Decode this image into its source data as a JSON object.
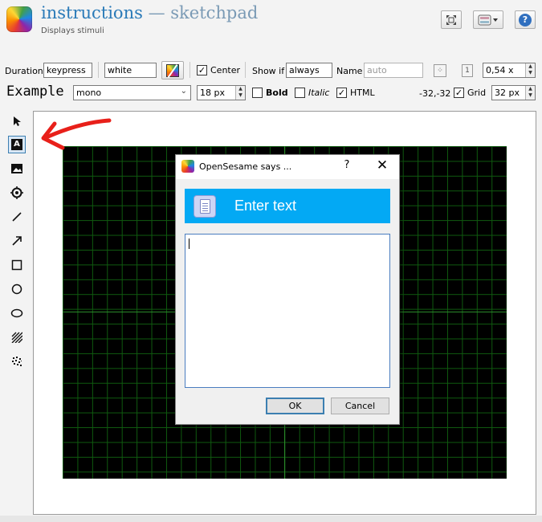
{
  "header": {
    "title": "instructions",
    "title_sep": "—",
    "plugin": "sketchpad",
    "subtitle": "Displays stimuli"
  },
  "settings_row": {
    "duration_label": "Duration",
    "duration_value": "keypress",
    "color_value": "white",
    "center_label": "Center",
    "center_checked": true,
    "show_if_label": "Show if",
    "show_if_value": "always",
    "name_label": "Name",
    "name_placeholder": "auto",
    "zoom_value": "0,54 x"
  },
  "style_row": {
    "example_text": "Example",
    "font_family": "mono",
    "font_size": "18 px",
    "bold_label": "Bold",
    "italic_label": "Italic",
    "html_label": "HTML",
    "html_checked": true,
    "coordinates": "-32,-32",
    "grid_label": "Grid",
    "grid_checked": true,
    "grid_size": "32 px"
  },
  "tools": [
    {
      "name": "pointer",
      "icon": "pointer-icon"
    },
    {
      "name": "text",
      "icon": "text-icon",
      "active": true
    },
    {
      "name": "image",
      "icon": "image-icon"
    },
    {
      "name": "fixdot",
      "icon": "fixdot-icon"
    },
    {
      "name": "line",
      "icon": "line-icon"
    },
    {
      "name": "arrow",
      "icon": "arrow-icon"
    },
    {
      "name": "rect",
      "icon": "rect-icon"
    },
    {
      "name": "circle",
      "icon": "circle-icon"
    },
    {
      "name": "ellipse",
      "icon": "ellipse-icon"
    },
    {
      "name": "gabor",
      "icon": "gabor-icon"
    },
    {
      "name": "noise",
      "icon": "noise-icon"
    }
  ],
  "dialog": {
    "title": "OpenSesame says ...",
    "help": "?",
    "banner_text": "Enter text",
    "text_value": "",
    "ok_label": "OK",
    "cancel_label": "Cancel"
  },
  "colors": {
    "title": "#2a7ab8",
    "banner": "#03a9f4",
    "canvas_bg": "#000000",
    "grid": "#0f5a0f",
    "annotation_arrow": "#e8201a"
  }
}
